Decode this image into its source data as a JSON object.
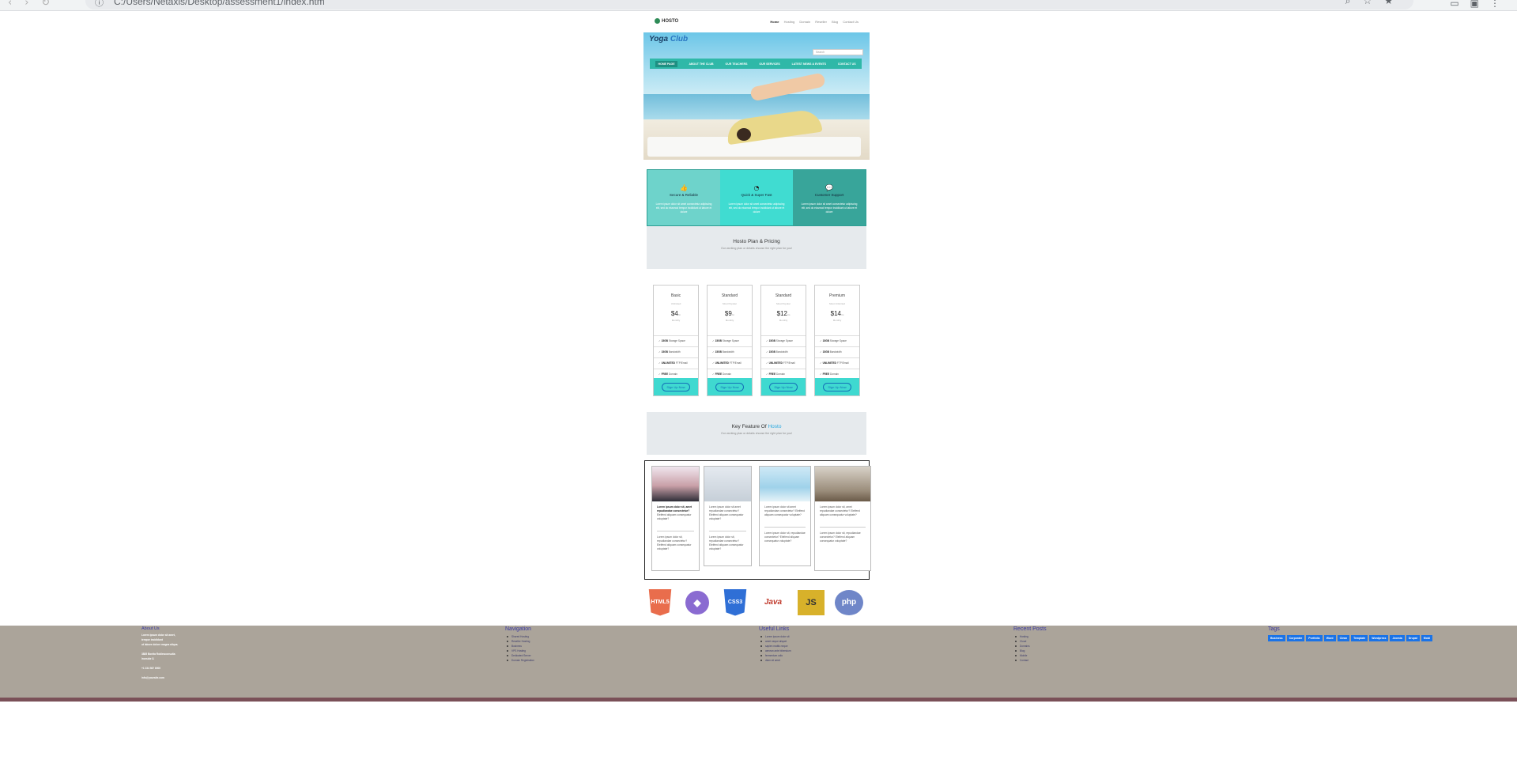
{
  "browser": {
    "address": "C:/Users/Netaxis/Desktop/assessment1/index.htm",
    "protocol": "File"
  },
  "site": {
    "logo": "HOSTO",
    "top_menu": [
      "Home",
      "Hosting",
      "Domain",
      "Reseller",
      "Blog",
      "Contact Us"
    ]
  },
  "hero": {
    "title_a": "Yoga",
    "title_b": "Club",
    "search_placeholder": "Search",
    "nav": [
      "HOME PAGE",
      "ABOUT THE CLUB",
      "OUR TEACHERS",
      "OUR SERVICES",
      "LATEST NEWS & EVENTS",
      "CONTACT US"
    ]
  },
  "features": [
    {
      "icon": "thumbs-up-icon",
      "glyph": "👍",
      "title": "Secure & Reliable",
      "text": "Lorem ipsum dolor sit amet consectetur adipiscing elit, sed do eiusmod tempor incididunt ut labore et dolore"
    },
    {
      "icon": "speedometer-icon",
      "glyph": "◔",
      "title": "Quick & Super Fast",
      "text": "Lorem ipsum dolor sit amet consectetur adipiscing elit, sed do eiusmod tempor incididunt ut labore et dolore"
    },
    {
      "icon": "chat-icon",
      "glyph": "💬",
      "title": "Customer Support",
      "text": "Lorem ipsum dolor sit amet consectetur adipiscing elit, sed do eiusmod tempor incididunt ut labore et dolore"
    }
  ],
  "pricing_section": {
    "title": "Hosto Plan & Pricing",
    "subtitle": "Our working plan or details choose the right plan for you!"
  },
  "plans": [
    {
      "name": "Basic",
      "sub": "Unlimited",
      "price": "$4",
      "unit": "/m",
      "per": "Monthly",
      "feats": [
        [
          "15GB",
          "Storage Space"
        ],
        [
          "15GB",
          "Bandwidth"
        ],
        [
          "UNLIMITED",
          "FTP/Email"
        ],
        [
          "FREE",
          "Domain"
        ]
      ],
      "cta": "Sign Up Now"
    },
    {
      "name": "Standard",
      "sub": "Most Popular",
      "price": "$9",
      "unit": "/m",
      "per": "Monthly",
      "feats": [
        [
          "15GB",
          "Storage Space"
        ],
        [
          "15GB",
          "Bandwidth"
        ],
        [
          "UNLIMITED",
          "FTP/Email"
        ],
        [
          "FREE",
          "Domain"
        ]
      ],
      "cta": "Sign Up Now"
    },
    {
      "name": "Standard",
      "sub": "Most Popular",
      "price": "$12",
      "unit": "/m",
      "per": "Monthly",
      "feats": [
        [
          "15GB",
          "Storage Space"
        ],
        [
          "15GB",
          "Bandwidth"
        ],
        [
          "UNLIMITED",
          "FTP/Email"
        ],
        [
          "FREE",
          "Domain"
        ]
      ],
      "cta": "Sign Up Now"
    },
    {
      "name": "Premium",
      "sub": "Most Unlimited",
      "price": "$14",
      "unit": "/m",
      "per": "Monthly",
      "feats": [
        [
          "15GB",
          "Storage Space"
        ],
        [
          "15GB",
          "Bandwidth"
        ],
        [
          "UNLIMITED",
          "FTP/Email"
        ],
        [
          "FREE",
          "Domain"
        ]
      ],
      "cta": "Sign Up Now"
    }
  ],
  "key_section": {
    "title": "Key Feature Of",
    "title_accent": "Hosto",
    "subtitle": "Our working plan or details choose the right plan for you!"
  },
  "cards": [
    {
      "head": "Lorem ipsum dolor sit, amet repudiandae consectetur?",
      "body": "Eleifend aliquam consequatur voluptate?",
      "foot": "Lorem ipsum dolor sit, repudiandae consectetur? Eleifend aliquam consequatur voluptate?"
    },
    {
      "head": "Lorem ipsum dolor sit amet repudiandae consectetur?",
      "body": "Eleifend aliquam consequatur voluptate?",
      "foot": "Lorem ipsum dolor sit, repudiandae consectetur? Eleifend aliquam consequatur voluptate?"
    },
    {
      "head": "Lorem ipsum dolor sit amet repudiandae consectetur?",
      "body": "Eleifend aliquam consequatur voluptate?",
      "foot": "Lorem ipsum dolor sit, repudiandae consectetur? Eleifend aliquam consequatur voluptate?"
    },
    {
      "head": "Lorem ipsum dolor sit, amet repudiandae consectetur?",
      "body": "Eleifend aliquam consequatur voluptate?",
      "foot": "Lorem ipsum dolor sit, repudiandae consectetur? Eleifend aliquam consequatur voluptate?"
    }
  ],
  "tech": [
    {
      "label": "HTML",
      "sub": "5",
      "color": "#e96d4c"
    },
    {
      "label": "◆",
      "sub": "",
      "color": "#8a6bd1"
    },
    {
      "label": "CSS",
      "sub": "3",
      "color": "#2f6fd6"
    },
    {
      "label": "Java",
      "sub": "",
      "color": "#c0392b"
    },
    {
      "label": "JS",
      "sub": "",
      "color": "#d8b12a"
    },
    {
      "label": "php",
      "sub": "",
      "color": "#6f86c8"
    }
  ],
  "footer": {
    "about": {
      "title": "About Us",
      "lines": [
        "Lorem ipsum dolor sit amet,",
        "tempor incididunt",
        "ut labore dolore magna aliqua.",
        "",
        "3885 Bonita Roblesconsulta",
        "Ironside I1",
        "",
        "+1 234 567 8900",
        "",
        "info@yoursite.com"
      ]
    },
    "navigation": {
      "title": "Navigation",
      "items": [
        "Shared Hosting",
        "Reseller Hosting",
        "Business",
        "VPS Hosting",
        "Dedicated Server",
        "Domain Registration"
      ]
    },
    "useful": {
      "title": "Useful Links",
      "items": [
        "Lorem ipsum dolor sit",
        "amet neque aliquet",
        "sapien mattis neque",
        "aenean ante bibendum",
        "fermentum odio",
        "diam sit amet"
      ]
    },
    "recent": {
      "title": "Recent Posts",
      "items": [
        "Hosting",
        "Cloud",
        "Domains",
        "Blog",
        "Mobile",
        "Contact"
      ]
    },
    "tags": {
      "title": "Tags",
      "items": [
        "Business",
        "Corporate",
        "Portfolio",
        "Word",
        "Clean",
        "Template",
        "Wordpress",
        "Joomla",
        "Drupal",
        "Mobi"
      ]
    }
  }
}
